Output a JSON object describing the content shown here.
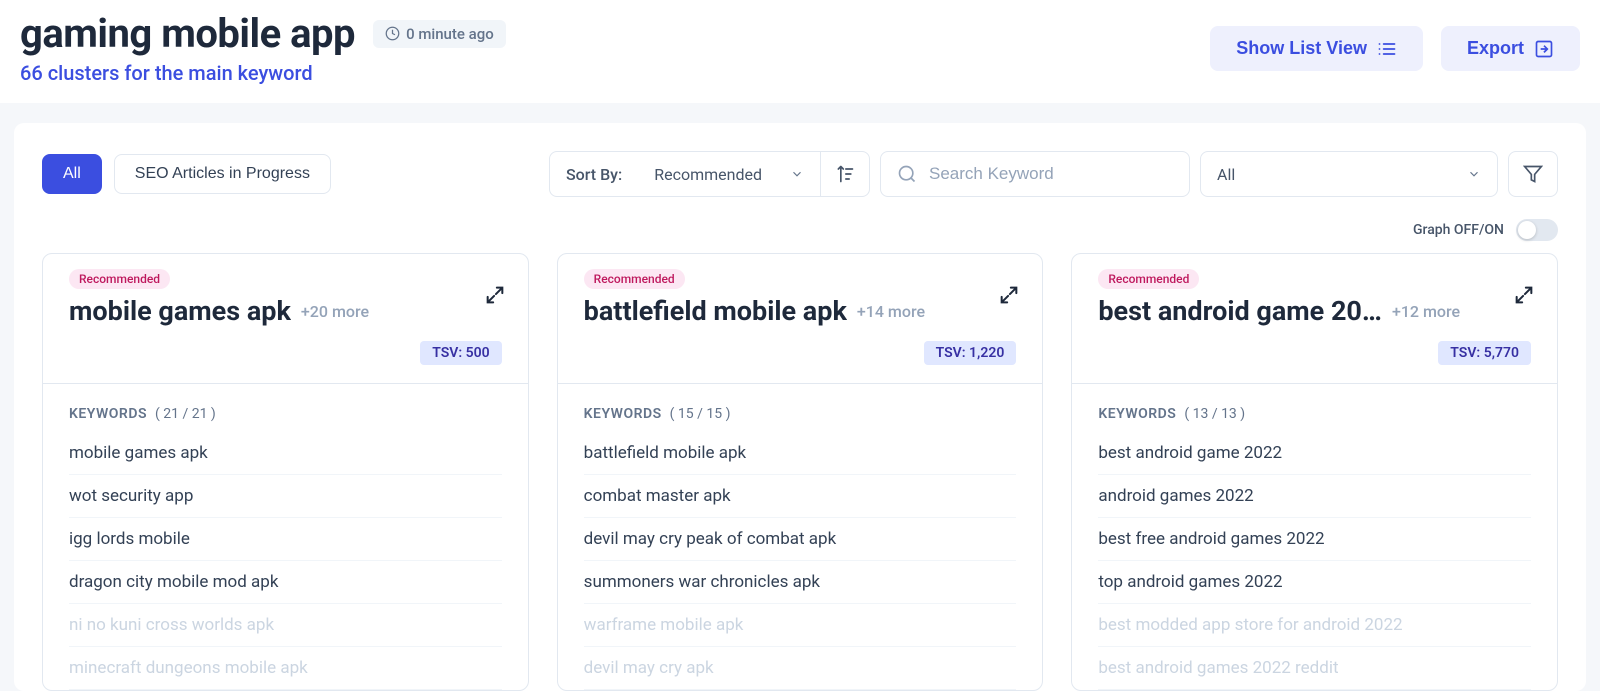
{
  "header": {
    "title": "gaming mobile app",
    "time_ago": "0 minute ago",
    "subtitle": "66 clusters for the main keyword",
    "list_view_label": "Show List View",
    "export_label": "Export"
  },
  "controls": {
    "tab_all": "All",
    "tab_seo": "SEO Articles in Progress",
    "sort_label": "Sort By:",
    "sort_value": "Recommended",
    "search_placeholder": "Search Keyword",
    "filter_value": "All",
    "graph_label": "Graph OFF/ON"
  },
  "cards": [
    {
      "badge": "Recommended",
      "title": "mobile games apk",
      "more": "+20 more",
      "tsv": "TSV: 500",
      "kw_label": "KEYWORDS",
      "kw_count": "( 21 / 21 )",
      "items": [
        {
          "text": "mobile games apk",
          "faded": false
        },
        {
          "text": "wot security app",
          "faded": false
        },
        {
          "text": "igg lords mobile",
          "faded": false
        },
        {
          "text": "dragon city mobile mod apk",
          "faded": false
        },
        {
          "text": "ni no kuni cross worlds apk",
          "faded": true
        },
        {
          "text": "minecraft dungeons mobile apk",
          "faded": true
        }
      ]
    },
    {
      "badge": "Recommended",
      "title": "battlefield mobile apk",
      "more": "+14 more",
      "tsv": "TSV: 1,220",
      "kw_label": "KEYWORDS",
      "kw_count": "( 15 / 15 )",
      "items": [
        {
          "text": "battlefield mobile apk",
          "faded": false
        },
        {
          "text": "combat master apk",
          "faded": false
        },
        {
          "text": "devil may cry peak of combat apk",
          "faded": false
        },
        {
          "text": "summoners war chronicles apk",
          "faded": false
        },
        {
          "text": "warframe mobile apk",
          "faded": true
        },
        {
          "text": "devil may cry apk",
          "faded": true
        }
      ]
    },
    {
      "badge": "Recommended",
      "title": "best android game 20…",
      "more": "+12 more",
      "tsv": "TSV: 5,770",
      "kw_label": "KEYWORDS",
      "kw_count": "( 13 / 13 )",
      "items": [
        {
          "text": "best android game 2022",
          "faded": false
        },
        {
          "text": "android games 2022",
          "faded": false
        },
        {
          "text": "best free android games 2022",
          "faded": false
        },
        {
          "text": "top android games 2022",
          "faded": false
        },
        {
          "text": "best modded app store for android 2022",
          "faded": true
        },
        {
          "text": "best android games 2022 reddit",
          "faded": true
        }
      ]
    }
  ]
}
